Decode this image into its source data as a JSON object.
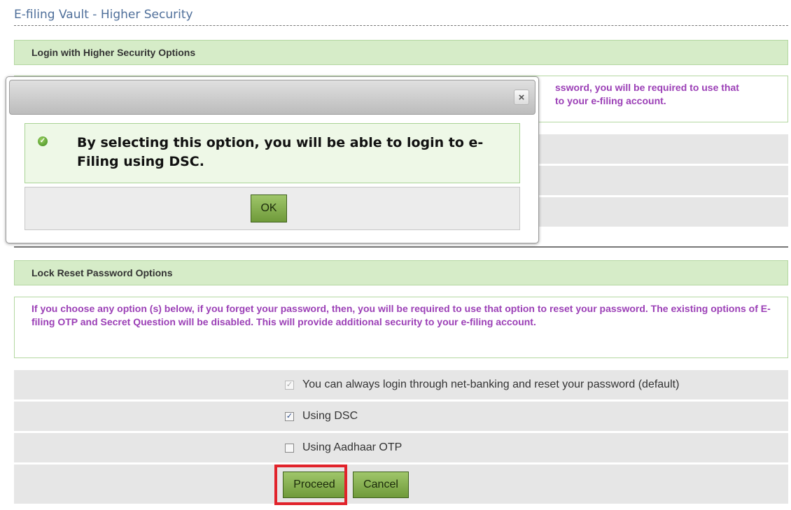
{
  "page": {
    "title": "E-filing Vault - Higher Security"
  },
  "login_section": {
    "header": "Login with Higher Security Options",
    "info_visible": "ssword, you will be required to use that\nto your e-filing account."
  },
  "lock_section": {
    "header": "Lock Reset Password Options",
    "info": "If you choose any option (s) below, if you forget your password, then, you will be required to use that option to reset your password. The existing options of E-filing OTP and Secret Question will be disabled. This will provide additional security to your e-filing account.",
    "options": [
      {
        "label": "You can always login through net-banking and reset your password (default)",
        "checked": true,
        "disabled": true
      },
      {
        "label": "Using DSC",
        "checked": true,
        "disabled": false
      },
      {
        "label": "Using Aadhaar OTP",
        "checked": false,
        "disabled": false
      }
    ],
    "proceed_label": "Proceed",
    "cancel_label": "Cancel"
  },
  "modal": {
    "close_symbol": "×",
    "message": "By selecting this option, you will be able to login to e-Filing using DSC.",
    "ok_label": "OK"
  },
  "colors": {
    "accent_green": "#6f9a3a",
    "info_purple": "#9b3fb6",
    "highlight_red": "#e1232b",
    "title_blue": "#4f6f9a"
  }
}
